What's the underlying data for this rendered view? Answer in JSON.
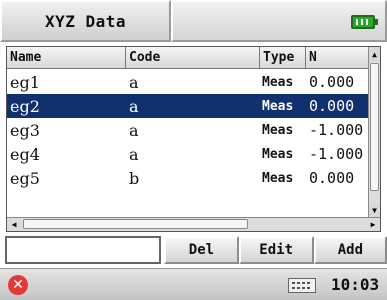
{
  "app": {
    "title": "XYZ Data"
  },
  "status_icons": {
    "battery": "battery-full-icon",
    "battery_color": "#2fa52f"
  },
  "table": {
    "columns": [
      "Name",
      "Code",
      "Type",
      "N"
    ],
    "rows": [
      {
        "name": "eg1",
        "code": "a",
        "type": "Meas",
        "n": "0.000",
        "selected": false
      },
      {
        "name": "eg2",
        "code": "a",
        "type": "Meas",
        "n": "0.000",
        "selected": true
      },
      {
        "name": "eg3",
        "code": "a",
        "type": "Meas",
        "n": "-1.000",
        "selected": false
      },
      {
        "name": "eg4",
        "code": "a",
        "type": "Meas",
        "n": "-1.000",
        "selected": false
      },
      {
        "name": "eg5",
        "code": "b",
        "type": "Meas",
        "n": "0.000",
        "selected": false
      }
    ],
    "selection_color": "#10306e"
  },
  "actions": {
    "input_value": "",
    "del_label": "Del",
    "edit_label": "Edit",
    "add_label": "Add"
  },
  "statusbar": {
    "close_icon": "close-icon",
    "keyboard_icon": "keyboard-icon",
    "time": "10:03"
  }
}
